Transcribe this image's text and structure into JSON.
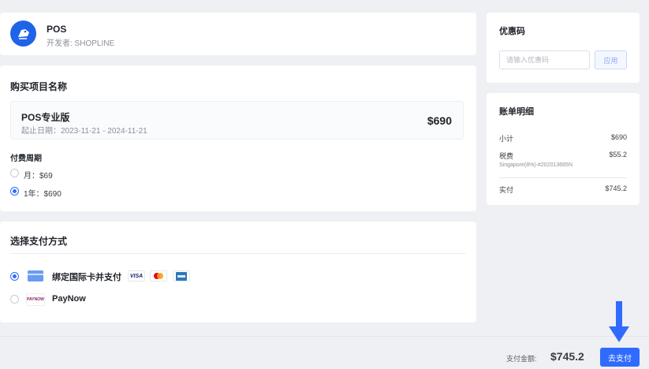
{
  "app": {
    "name": "POS",
    "developer": "开发者: SHOPLINE"
  },
  "purchase": {
    "title": "购买项目名称",
    "product": {
      "name": "POS专业版",
      "dates": "起止日期：2023-11-21 - 2024-11-21",
      "price": "$690"
    },
    "period_title": "付费周期",
    "options": [
      {
        "label": "月：$69",
        "selected": false
      },
      {
        "label": "1年：$690",
        "selected": true
      }
    ]
  },
  "payment": {
    "title": "选择支付方式",
    "methods": [
      {
        "label": "绑定国际卡并支付",
        "selected": true,
        "icons": [
          "card-icon",
          "visa-icon",
          "mastercard-icon",
          "amex-icon"
        ]
      },
      {
        "label": "PayNow",
        "selected": false,
        "icons": [
          "paynow-icon"
        ]
      }
    ],
    "brands": {
      "visa": "VISA",
      "paynow": "PAYNOW"
    }
  },
  "coupon": {
    "title": "优惠码",
    "placeholder": "请输入优惠码",
    "apply_label": "应用"
  },
  "bill": {
    "title": "账单明细",
    "subtotal_label": "小计",
    "subtotal_value": "$690",
    "tax_label": "税费",
    "tax_value": "$55.2",
    "tax_note": "Singapore(8%)-#202013665N",
    "paid_label": "实付",
    "paid_value": "$745.2"
  },
  "footer": {
    "total_label": "支付金额:",
    "total_amount": "$745.2",
    "pay_label": "去支付"
  },
  "colors": {
    "accent": "#2f6bff",
    "logo": "#1e63e8"
  }
}
